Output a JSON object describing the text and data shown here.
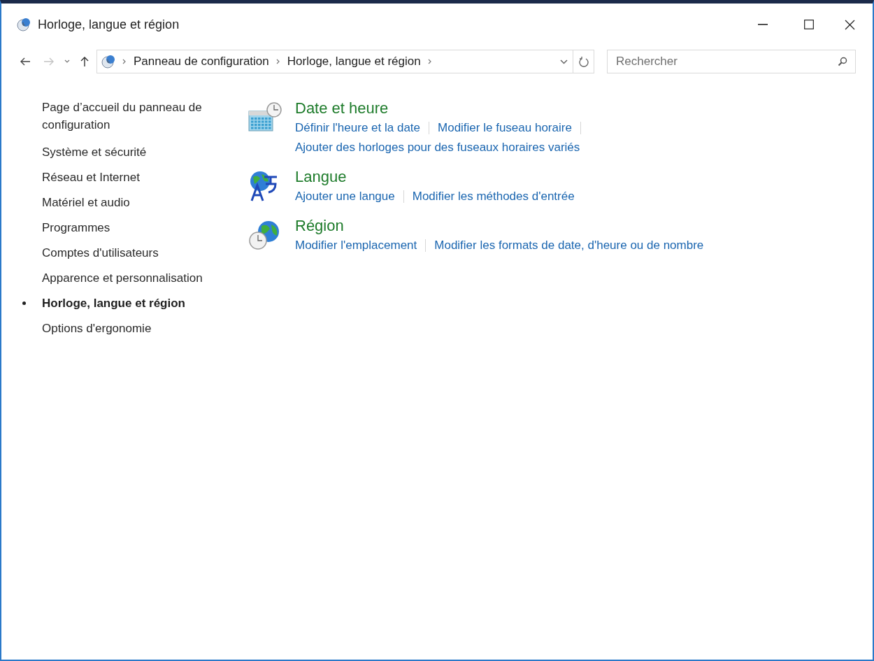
{
  "window": {
    "title": "Horloge, langue et région"
  },
  "address_bar": {
    "breadcrumbs": [
      "Panneau de configuration",
      "Horloge, langue et région"
    ]
  },
  "search": {
    "placeholder": "Rechercher"
  },
  "sidebar": {
    "items": [
      {
        "label": "Page d’accueil du panneau de configuration",
        "selected": false
      },
      {
        "label": "Système et sécurité",
        "selected": false
      },
      {
        "label": "Réseau et Internet",
        "selected": false
      },
      {
        "label": "Matériel et audio",
        "selected": false
      },
      {
        "label": "Programmes",
        "selected": false
      },
      {
        "label": "Comptes d'utilisateurs",
        "selected": false
      },
      {
        "label": "Apparence et personnalisation",
        "selected": false
      },
      {
        "label": "Horloge, langue et région",
        "selected": true
      },
      {
        "label": "Options d'ergonomie",
        "selected": false
      }
    ]
  },
  "categories": [
    {
      "kind": "calendar-clock",
      "title": "Date et heure",
      "link_rows": [
        {
          "links": [
            "Définir l'heure et la date",
            "Modifier le fuseau horaire"
          ],
          "trailing_separator": true
        },
        {
          "links": [
            "Ajouter des horloges pour des fuseaux horaires variés"
          ],
          "trailing_separator": false
        }
      ]
    },
    {
      "kind": "globe-letters",
      "title": "Langue",
      "link_rows": [
        {
          "links": [
            "Ajouter une langue",
            "Modifier les méthodes d'entrée"
          ],
          "trailing_separator": false
        }
      ]
    },
    {
      "kind": "globe-clock",
      "title": "Région",
      "link_rows": [
        {
          "links": [
            "Modifier l'emplacement",
            "Modifier les formats de date, d'heure ou de nombre"
          ],
          "trailing_separator": false
        }
      ]
    }
  ]
}
